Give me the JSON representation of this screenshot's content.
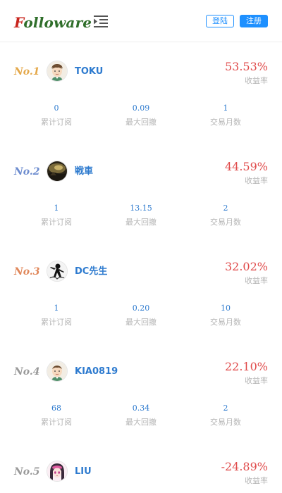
{
  "header": {
    "logo_first": "F",
    "logo_rest": "olloware",
    "login_label": "登陆",
    "register_label": "注册"
  },
  "colors": {
    "accent": "#1e90ff",
    "rate_red": "#e04b4b",
    "name_blue": "#2e7bcf"
  },
  "stat_labels": {
    "subscriptions": "累计订阅",
    "max_drawdown": "最大回撤",
    "trading_months": "交易月数"
  },
  "rate_label": "收益率",
  "rankings": [
    {
      "rank": "No.1",
      "rank_color": "#e4a84a",
      "name": "TOKU",
      "rate": "53.53%",
      "subscriptions": "0",
      "max_drawdown": "0.09",
      "trading_months": "1",
      "avatar_icon": "cartoon-boy-avatar-icon"
    },
    {
      "rank": "No.2",
      "rank_color": "#6d8ccf",
      "name": "戦車",
      "rate": "44.59%",
      "subscriptions": "1",
      "max_drawdown": "13.15",
      "trading_months": "2",
      "avatar_icon": "dark-landscape-avatar-icon"
    },
    {
      "rank": "No.3",
      "rank_color": "#e0875a",
      "name": "DC先生",
      "rate": "32.02%",
      "subscriptions": "1",
      "max_drawdown": "0.20",
      "trading_months": "10",
      "avatar_icon": "ink-figure-avatar-icon"
    },
    {
      "rank": "No.4",
      "rank_color": "#999999",
      "name": "KIA0819",
      "rate": "22.10%",
      "subscriptions": "68",
      "max_drawdown": "0.34",
      "trading_months": "2",
      "avatar_icon": "cartoon-boy-avatar-icon"
    },
    {
      "rank": "No.5",
      "rank_color": "#999999",
      "name": "LIU",
      "rate": "-24.89%",
      "subscriptions": "",
      "max_drawdown": "",
      "trading_months": "",
      "avatar_icon": "anime-girl-avatar-icon"
    }
  ]
}
